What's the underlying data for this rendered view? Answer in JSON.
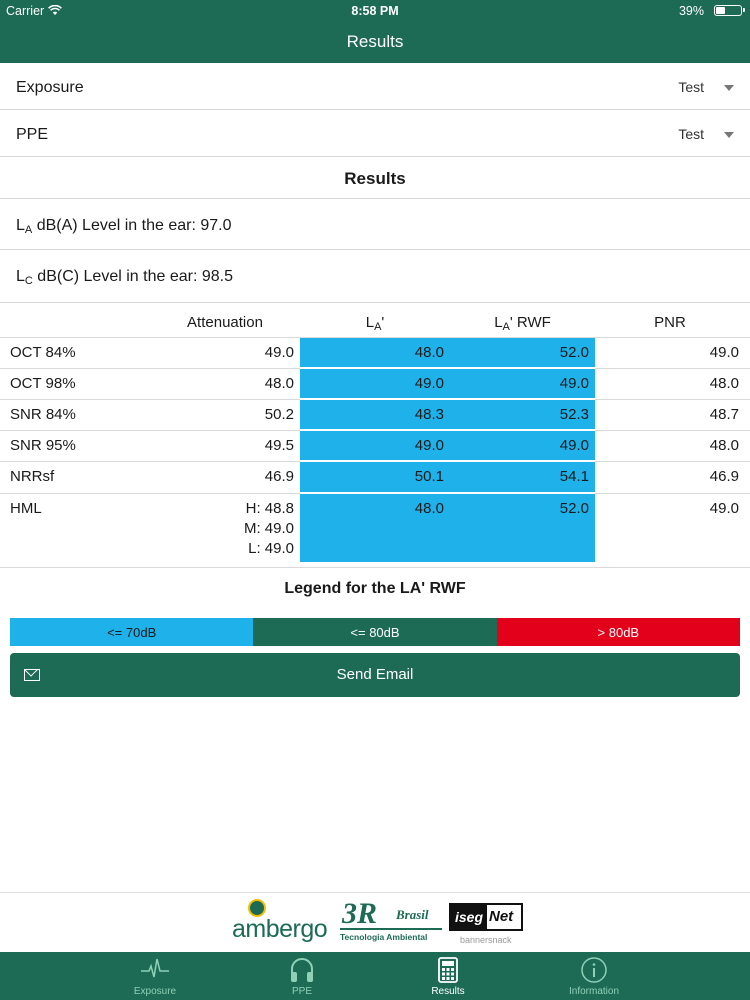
{
  "status": {
    "carrier": "Carrier",
    "time": "8:58 PM",
    "battery": "39%",
    "battery_level": 0.39
  },
  "header": {
    "title": "Results"
  },
  "selectors": [
    {
      "label": "Exposure",
      "value": "Test"
    },
    {
      "label": "PPE",
      "value": "Test"
    }
  ],
  "results": {
    "title": "Results",
    "la_prefix": "L",
    "la_sub": "A",
    "la_text": " dB(A) Level in the ear: 97.0",
    "lc_prefix": "L",
    "lc_sub": "C",
    "lc_text": " dB(C) Level in the ear: 98.5"
  },
  "table": {
    "headers": {
      "attenuation": "Attenuation",
      "la_prefix": "L",
      "la_sub": "A",
      "la_suffix": "'",
      "larwf_prefix": "L",
      "larwf_sub": "A",
      "larwf_suffix": "' RWF",
      "pnr": "PNR"
    },
    "rows": [
      {
        "name": "OCT 84%",
        "att": "49.0",
        "la": "48.0",
        "larwf": "52.0",
        "pnr": "49.0"
      },
      {
        "name": "OCT 98%",
        "att": "48.0",
        "la": "49.0",
        "larwf": "49.0",
        "pnr": "48.0"
      },
      {
        "name": "SNR 84%",
        "att": "50.2",
        "la": "48.3",
        "larwf": "52.3",
        "pnr": "48.7"
      },
      {
        "name": "SNR 95%",
        "att": "49.5",
        "la": "49.0",
        "larwf": "49.0",
        "pnr": "48.0"
      },
      {
        "name": "NRRsf",
        "att": "46.9",
        "la": "50.1",
        "larwf": "54.1",
        "pnr": "46.9"
      },
      {
        "name": "HML",
        "att_h": "H: 48.8",
        "att_m": "M: 49.0",
        "att_l": "L: 49.0",
        "la": "48.0",
        "larwf": "52.0",
        "pnr": "49.0"
      }
    ]
  },
  "legend": {
    "title": "Legend for the LA' RWF",
    "items": [
      {
        "label": "<= 70dB",
        "color": "#1fb2ea",
        "text_color": "#1a1a1a"
      },
      {
        "label": "<= 80dB",
        "color": "#1d6b54",
        "text_color": "#ffffff"
      },
      {
        "label": "> 80dB",
        "color": "#e2001a",
        "text_color": "#ffffff"
      }
    ]
  },
  "send_email": {
    "label": "Send Email"
  },
  "sponsors": {
    "ambergo": "ambergo",
    "threer": "3R",
    "threer_script": "Brasil",
    "threer_sub": "Tecnologia Ambiental",
    "iseg": "iseg",
    "net": "Net",
    "bannersnack": "bannersnack"
  },
  "tabs": [
    {
      "label": "Exposure",
      "icon": "heartbeat-icon",
      "active": false
    },
    {
      "label": "PPE",
      "icon": "headphones-icon",
      "active": false
    },
    {
      "label": "Results",
      "icon": "calculator-icon",
      "active": true
    },
    {
      "label": "Information",
      "icon": "info-icon",
      "active": false
    }
  ],
  "colors": {
    "primary": "#1d6b54",
    "highlight": "#1fb2ea",
    "danger": "#e2001a"
  }
}
